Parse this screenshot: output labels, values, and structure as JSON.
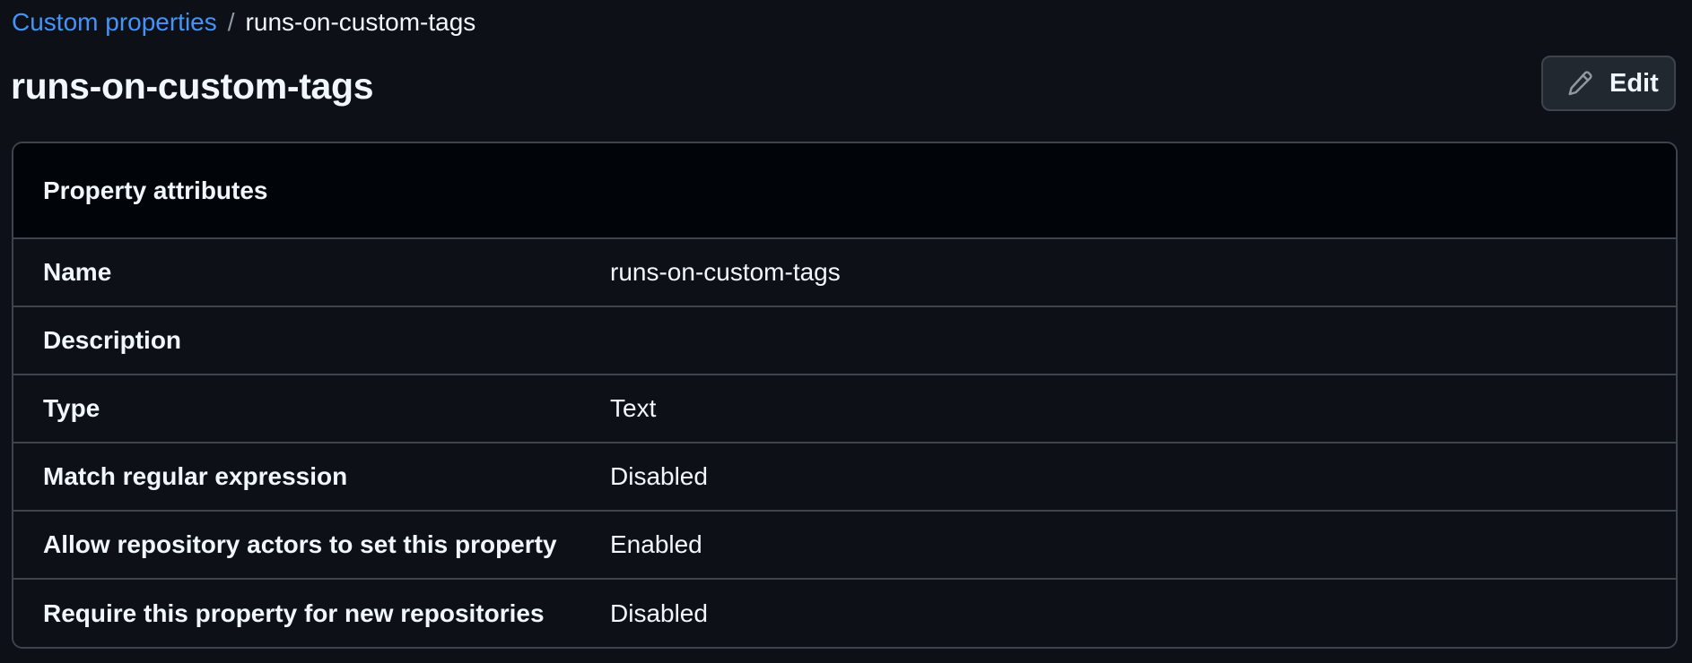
{
  "breadcrumb": {
    "parent": "Custom properties",
    "separator": "/",
    "current": "runs-on-custom-tags"
  },
  "page": {
    "title": "runs-on-custom-tags"
  },
  "edit_button": {
    "label": "Edit",
    "icon": "pencil-icon"
  },
  "panel": {
    "title": "Property attributes",
    "rows": [
      {
        "label": "Name",
        "value": "runs-on-custom-tags"
      },
      {
        "label": "Description",
        "value": ""
      },
      {
        "label": "Type",
        "value": "Text"
      },
      {
        "label": "Match regular expression",
        "value": "Disabled"
      },
      {
        "label": "Allow repository actors to set this property",
        "value": "Enabled"
      },
      {
        "label": "Require this property for new repositories",
        "value": "Disabled"
      }
    ]
  },
  "colors": {
    "background": "#0d1117",
    "header_background": "#010409",
    "border": "#3d444d",
    "link": "#4493f8",
    "text": "#f0f6fc",
    "button_background": "#212830"
  }
}
